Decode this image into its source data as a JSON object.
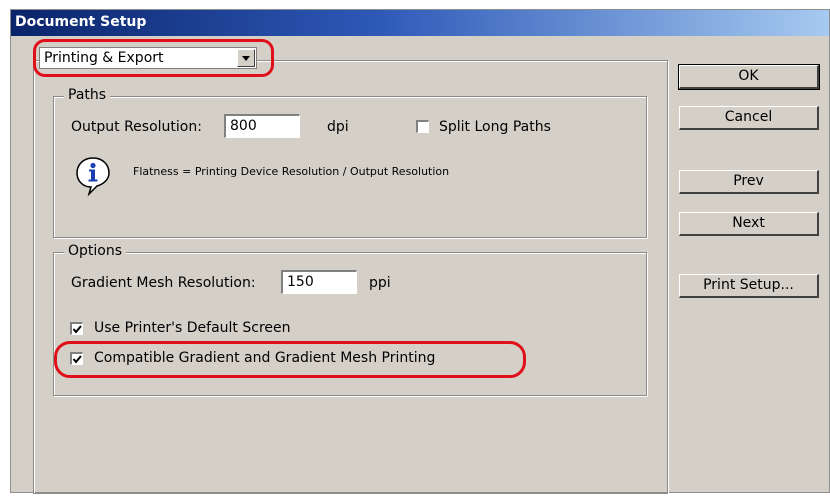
{
  "window": {
    "title": "Document Setup"
  },
  "panel_select": {
    "value": "Printing & Export"
  },
  "paths": {
    "legend": "Paths",
    "output_resolution_label": "Output Resolution:",
    "output_resolution_value": "800",
    "output_resolution_unit": "dpi",
    "split_long_paths_label": "Split Long Paths",
    "split_long_paths_checked": false,
    "info_text": "Flatness = Printing Device Resolution / Output Resolution"
  },
  "options": {
    "legend": "Options",
    "gradient_mesh_label": "Gradient Mesh Resolution:",
    "gradient_mesh_value": "150",
    "gradient_mesh_unit": "ppi",
    "use_printer_screen_label": "Use Printer's Default Screen",
    "use_printer_screen_checked": true,
    "compatible_gradient_label": "Compatible Gradient and Gradient Mesh Printing",
    "compatible_gradient_checked": true
  },
  "buttons": {
    "ok": "OK",
    "cancel": "Cancel",
    "prev": "Prev",
    "next": "Next",
    "print_setup": "Print Setup..."
  },
  "colors": {
    "highlight": "#e0101a",
    "titlebar": "#0a246a",
    "dialog_bg": "#d4d0c8"
  }
}
